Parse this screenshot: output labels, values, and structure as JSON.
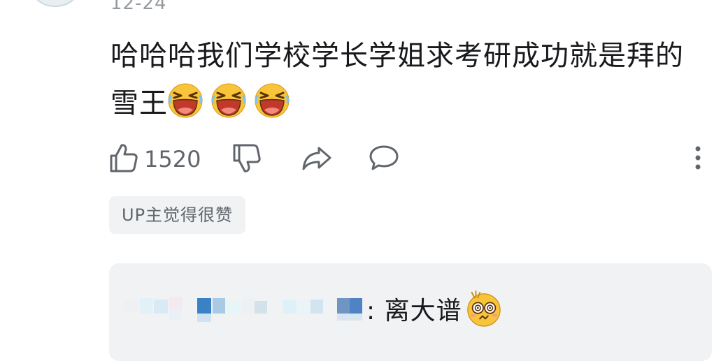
{
  "comment": {
    "timestamp": "12-24",
    "text": "哈哈哈我们学校学长学姐求考研成功就是拜的雪王",
    "emojis": [
      "laughing-cry-icon",
      "laughing-cry-icon",
      "laughing-cry-icon"
    ]
  },
  "actions": {
    "like_count": "1520"
  },
  "badge": {
    "label": "UP主觉得很赞"
  },
  "reply": {
    "text": ": 离大谱",
    "emoji": "dizzy-shocked-face-icon"
  },
  "colors": {
    "text_primary": "#18191c",
    "text_secondary": "#61666d",
    "text_muted": "#9499a0",
    "chip_bg": "#f1f2f3",
    "emoji_yellow": "#f8c43a",
    "emoji_mouth": "#c0392b"
  }
}
